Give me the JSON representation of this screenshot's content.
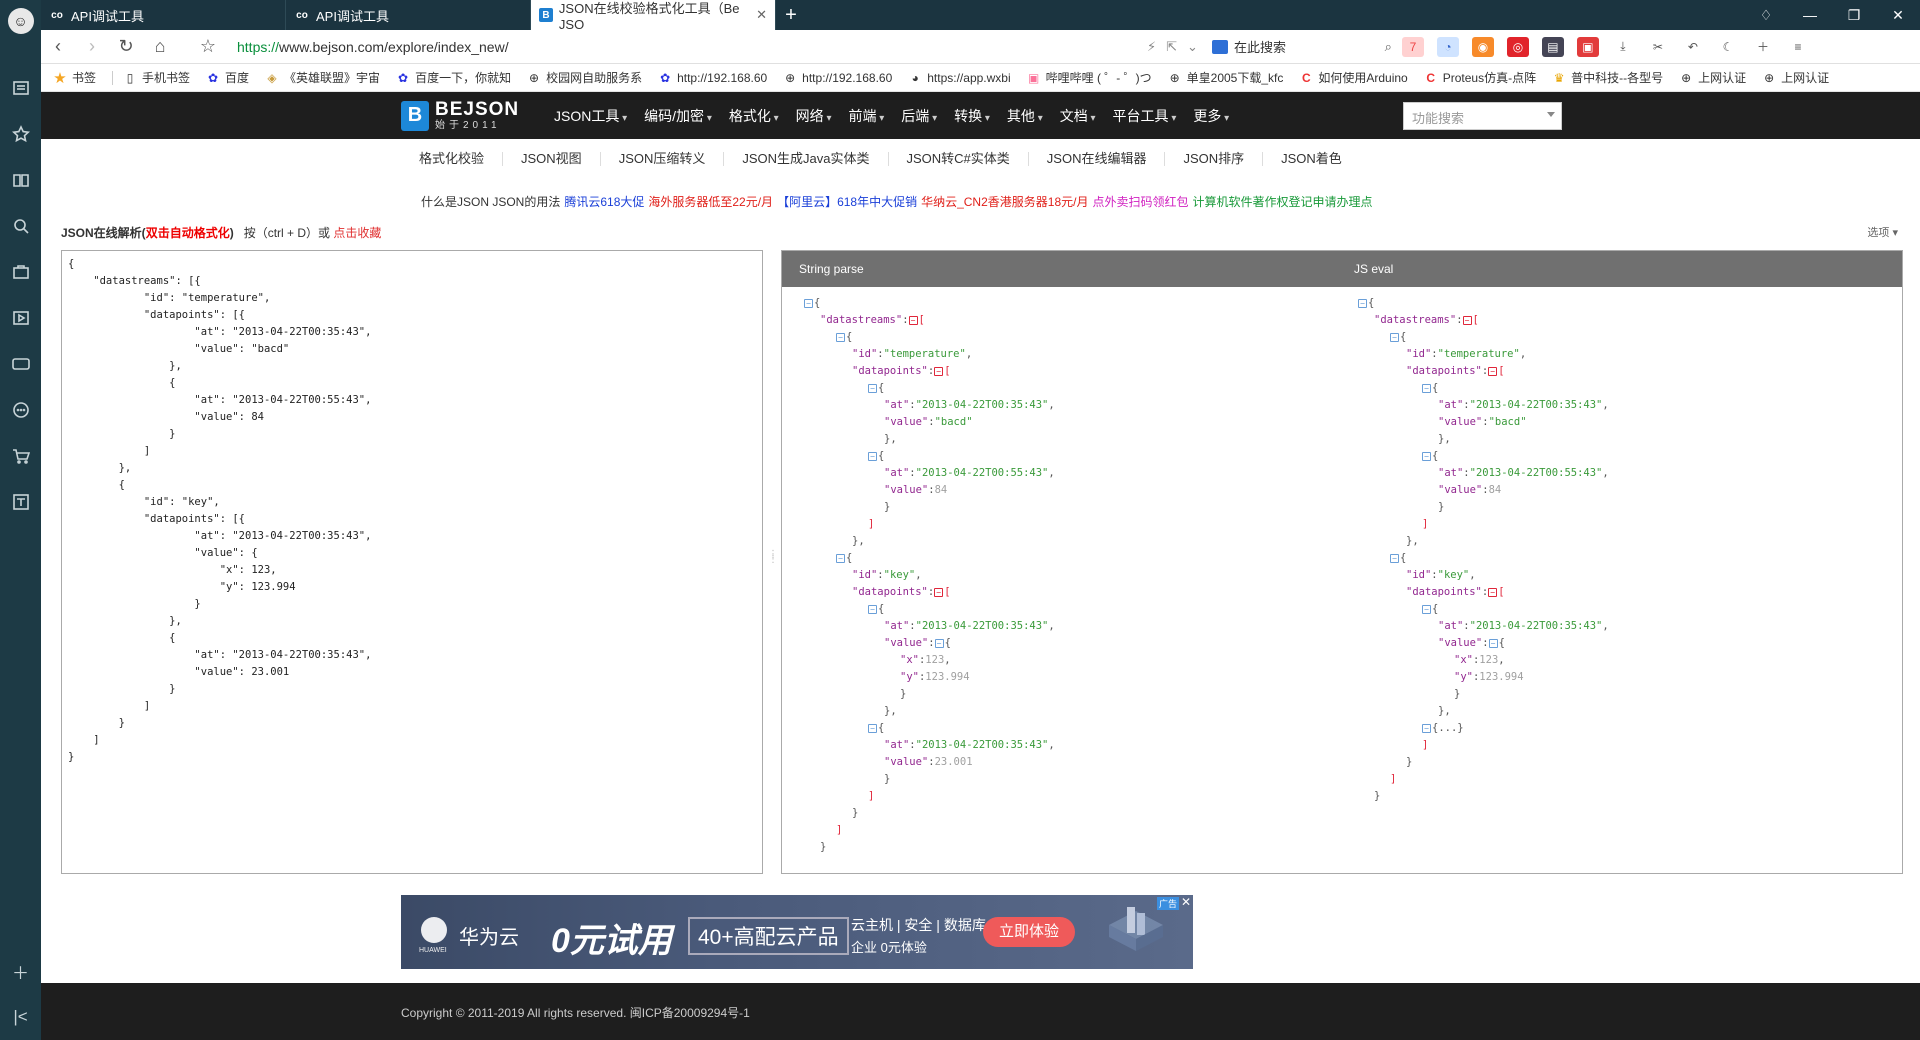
{
  "browser": {
    "tabs": [
      {
        "title": "API调试工具",
        "favicon": "co"
      },
      {
        "title": "API调试工具",
        "favicon": "co"
      },
      {
        "title": "JSON在线校验格式化工具（Be JSO",
        "favicon": "B"
      }
    ],
    "url_scheme": "https://",
    "url_rest": "www.bejson.com/explore/index_new/",
    "search_placeholder": "在此搜索",
    "bookmarks": [
      "书签",
      "手机书签",
      "百度",
      "《英雄联盟》宇宙",
      "百度一下，你就知",
      "校园网自助服务系",
      "http://192.168.60",
      "http://192.168.60",
      "https://app.wxbi",
      "哔哩哔哩 ( ゜- ゜)つ",
      "单皇2005下载_kfc",
      "如何使用Arduino",
      "Proteus仿真-点阵",
      "普中科技--各型号",
      "上网认证",
      "上网认证"
    ]
  },
  "site": {
    "logo_b": "B",
    "logo_name": "BEJSON",
    "logo_sub": "始于2011",
    "menu": [
      "JSON工具",
      "编码/加密",
      "格式化",
      "网络",
      "前端",
      "后端",
      "转换",
      "其他",
      "文档",
      "平台工具",
      "更多"
    ],
    "func_search": "功能搜索",
    "subnav": [
      "格式化校验",
      "JSON视图",
      "JSON压缩转义",
      "JSON生成Java实体类",
      "JSON转C#实体类",
      "JSON在线编辑器",
      "JSON排序",
      "JSON着色"
    ],
    "ads_line": [
      {
        "text": "什么是JSON JSON的用法",
        "color": "#333333"
      },
      {
        "text": "腾讯云618大促",
        "color": "#1a3fd8"
      },
      {
        "text": "海外服务器低至22元/月",
        "color": "#e0201a"
      },
      {
        "text": "【阿里云】618年中大促销",
        "color": "#1a3fd8"
      },
      {
        "text": "华纳云_CN2香港服务器18元/月",
        "color": "#e0201a"
      },
      {
        "text": "点外卖扫码领红包",
        "color": "#d020c0"
      },
      {
        "text": "计算机软件著作权登记申请办理点",
        "color": "#1a9a3a"
      }
    ],
    "title_prefix": "JSON在线解析(",
    "title_red": "双击自动格式化",
    "title_suffix": ")",
    "title_hint": "按（ctrl + D）或",
    "title_link": "点击收藏",
    "options": "选项 ▾",
    "input_json": "{\n    \"datastreams\": [{\n            \"id\": \"temperature\",\n            \"datapoints\": [{\n                    \"at\": \"2013-04-22T00:35:43\",\n                    \"value\": \"bacd\"\n                },\n                {\n                    \"at\": \"2013-04-22T00:55:43\",\n                    \"value\": 84\n                }\n            ]\n        },\n        {\n            \"id\": \"key\",\n            \"datapoints\": [{\n                    \"at\": \"2013-04-22T00:35:43\",\n                    \"value\": {\n                        \"x\": 123,\n                        \"y\": 123.994\n                    }\n                },\n                {\n                    \"at\": \"2013-04-22T00:35:43\",\n                    \"value\": 23.001\n                }\n            ]\n        }\n    ]\n}",
    "output_headers": [
      "String parse",
      "JS eval"
    ],
    "ad": {
      "brand": "华为云",
      "brand_sub": "HUAWEI",
      "zero": "0元试用",
      "box": "40+高配云产品",
      "t1": "云主机 | 安全 | 数据库",
      "t2": "企业 0元体验",
      "btn": "立即体验",
      "tag": "广告"
    },
    "footer": "Copyright © 2011-2019 All rights reserved. 闽ICP备20009294号-1"
  }
}
